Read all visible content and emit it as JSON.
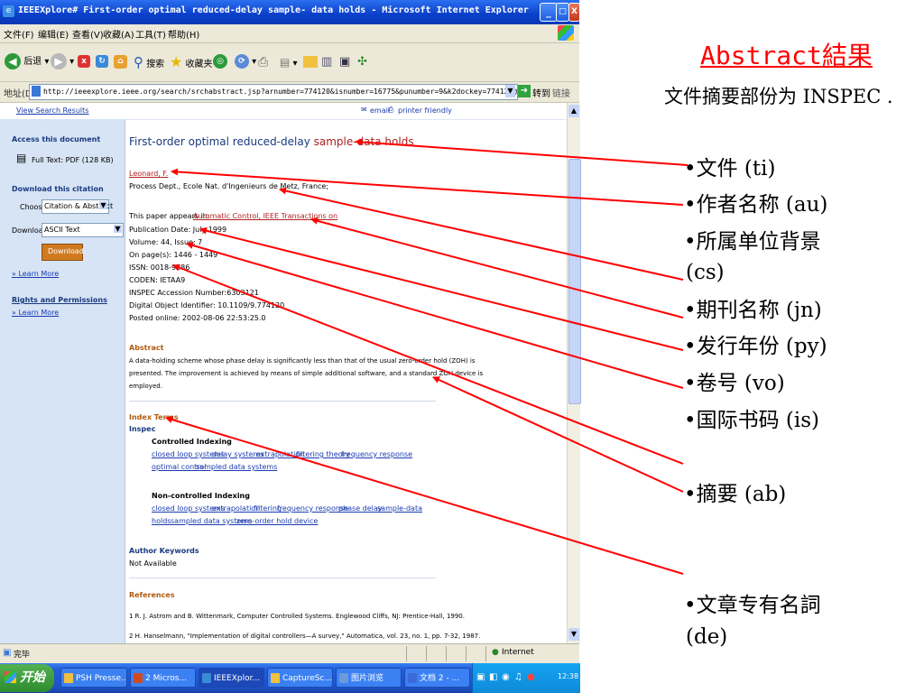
{
  "window": {
    "title": "IEEEXplore# First-order optimal reduced-delay sample- data holds - Microsoft Internet Explorer",
    "min": "_",
    "max": "□",
    "close": "X"
  },
  "menu": [
    "文件(F)",
    "编辑(E)",
    "查看(V)",
    "收藏(A)",
    "工具(T)",
    "帮助(H)"
  ],
  "toolbar": {
    "back": "后退",
    "search": "搜索",
    "favorites": "收藏夹"
  },
  "address": {
    "label": "地址(D)",
    "url": "http://ieeexplore.ieee.org/search/srchabstract.jsp?arnumber=774120&isnumber=16775&punumber=9&k2dockey=774120@ieeejrns&query=%28%28samp",
    "go": "转到",
    "links": "链接"
  },
  "page": {
    "view_search_results": "View Search Results",
    "email": "email",
    "printer_friendly": "printer friendly",
    "sidebar": {
      "access_heading": "Access this document",
      "full_text": "Full Text: PDF (128 KB)",
      "download_heading": "Download this citation",
      "choose_label": "Choose",
      "choose_value": "Citation & Abstract",
      "download_label": "Download",
      "download_value": "ASCII Text",
      "download_button": "Download",
      "learn_more": "» Learn More",
      "rights_heading": "Rights and Permissions",
      "rights_learn_more": "» Learn More"
    },
    "article_title_plain": "First-order optimal reduced-delay ",
    "article_title_red": "sample-data holds",
    "author": "Leonard, F.",
    "affiliation": "Process Dept., Ecole Nat. d'Ingenieurs de Metz, France;",
    "appears_in": "This paper appears in:",
    "journal": "Automatic Control, IEEE Transactions on",
    "pub_date": "Publication Date: July 1999",
    "volume": "Volume: 44, Issue: 7",
    "pages": "On page(s): 1446 - 1449",
    "issn": "ISSN: 0018-9286",
    "coden": "CODEN: IETAA9",
    "inspec": "INSPEC Accession Number:6303121",
    "doi": "Digital Object Identifier: 10.1109/9.774120",
    "posted": "Posted online: 2002-08-06 22:53:25.0",
    "abstract_heading": "Abstract",
    "abstract_lines": [
      "A data-holding scheme whose phase delay is significantly less than that of the usual zero-order hold (ZOH) is",
      "presented. The improvement is achieved by means of simple additional software, and a standard ZOH device is",
      "employed."
    ],
    "index_terms": "Index Terms",
    "inspec_label": "Inspec",
    "controlled": "Controlled Indexing",
    "controlled_terms_1": [
      "closed loop systems",
      "delay systems",
      "extrapolation",
      "filtering theory",
      "frequency response"
    ],
    "controlled_terms_2": [
      "optimal control",
      "sampled data systems"
    ],
    "noncontrolled": "Non-controlled Indexing",
    "noncontrolled_terms_1": [
      "closed loop systems",
      "extrapolation",
      "filtering",
      "frequency response",
      "phase delay",
      "sample-data"
    ],
    "noncontrolled_terms_2": [
      "holds",
      "sampled data systems",
      "zero-order hold device"
    ],
    "author_keywords": "Author Keywords",
    "not_available": "Not Available",
    "references": "References",
    "ref1": "1   R. J. Astrom and B. Wittenmark, Computer Controlled Systems. Englewood Cliffs, NJ: Prentice-Hall, 1990.",
    "ref2": "2   H. Hanselmann, \"Implementation of digital controllers—A survey,\" Automatica, vol. 23, no. 1, pp. 7-32, 1987."
  },
  "status": {
    "left": "完毕",
    "zone": "Internet"
  },
  "taskbar": {
    "start": "开始",
    "tasks": [
      "PSH Presse...",
      "2 Micros...",
      "IEEEXplor...",
      "CaptureSc...",
      "图片浏览",
      "文档 2 - ..."
    ],
    "clock": "12:38"
  },
  "slide": {
    "title": "Abstract結果",
    "intro": "文件摘要部份为 INSPEC .",
    "bullets": [
      "•文件 (ti)",
      "•作者名称 (au)",
      "•所属单位背景",
      "(cs)",
      "•期刊名称 (jn)",
      "•发行年份 (py)",
      "•卷号 (vo)",
      "•国际书码 (is)",
      "•摘要 (ab)",
      "•文章专有名詞",
      "(de)"
    ]
  },
  "colors": {
    "arrow": "#ff0000",
    "title_red": "#ff0000",
    "ie_blue": "#0a3fc9"
  }
}
